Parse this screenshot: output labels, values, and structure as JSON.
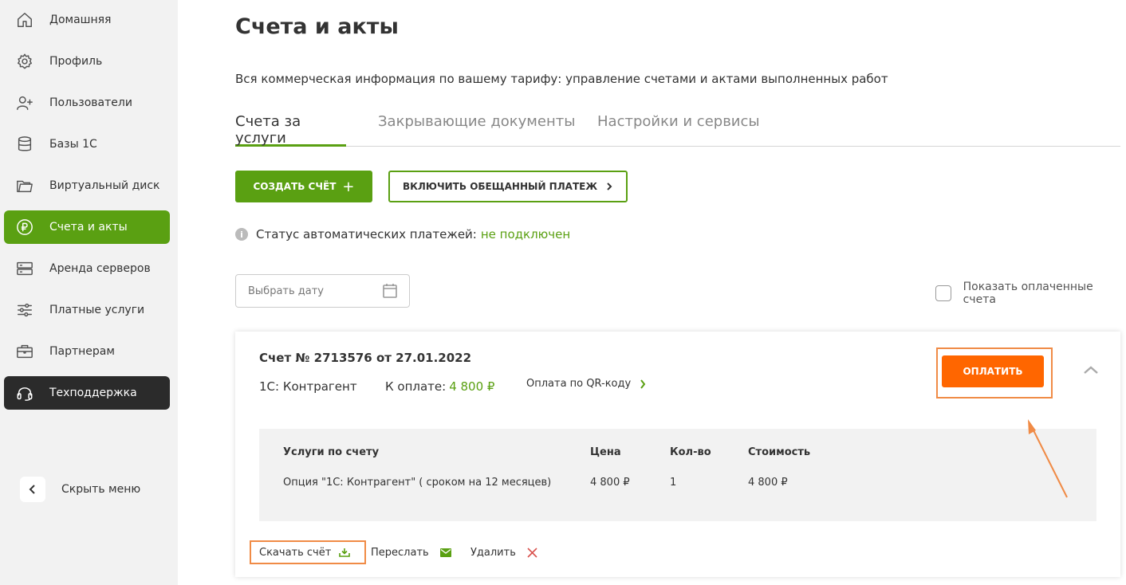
{
  "sidebar": {
    "items": [
      {
        "label": "Домашняя",
        "icon": "home-icon"
      },
      {
        "label": "Профиль",
        "icon": "gear-icon"
      },
      {
        "label": "Пользователи",
        "icon": "add-user-icon"
      },
      {
        "label": "Базы 1С",
        "icon": "database-icon"
      },
      {
        "label": "Виртуальный диск",
        "icon": "folder-icon"
      },
      {
        "label": "Счета и акты",
        "icon": "ruble-icon"
      },
      {
        "label": "Аренда серверов",
        "icon": "server-icon"
      },
      {
        "label": "Платные услуги",
        "icon": "sliders-icon"
      },
      {
        "label": "Партнерам",
        "icon": "briefcase-icon"
      },
      {
        "label": "Техподдержка",
        "icon": "headset-icon"
      }
    ],
    "hide_menu": "Скрыть меню"
  },
  "main": {
    "title": "Счета и акты",
    "subtitle": "Вся коммерческая информация по вашему тарифу: управление счетами и актами выполненных работ",
    "tabs": [
      {
        "label": "Счета за услуги"
      },
      {
        "label": "Закрывающие документы"
      },
      {
        "label": "Настройки и сервисы"
      }
    ],
    "create_button": "СОЗДАТЬ СЧЁТ",
    "create_plus": "+",
    "promise_button": "ВКЛЮЧИТЬ ОБЕЩАННЫЙ ПЛАТЕЖ",
    "status_info": "i",
    "status_label": "Статус автоматических платежей:",
    "status_value": "не подключен",
    "date_placeholder": "Выбрать дату",
    "show_paid": "Показать оплаченные счета"
  },
  "invoice": {
    "title": "Счет № 2713576 от 27.01.2022",
    "service": "1С: Контрагент",
    "due_label": "К оплате:",
    "due_amount": "4 800 ₽",
    "qr_link": "Оплата по QR-коду",
    "pay_button": "ОПЛАТИТЬ",
    "table": {
      "headers": [
        "Услуги по счету",
        "Цена",
        "Кол-во",
        "Стоимость"
      ],
      "rows": [
        [
          "Опция \"1С: Контрагент\" ( сроком на 12 месяцев)",
          "4 800 ₽",
          "1",
          "4 800 ₽"
        ]
      ]
    },
    "actions": {
      "download": "Скачать счёт",
      "forward": "Переслать",
      "delete": "Удалить"
    }
  },
  "colors": {
    "accent_green": "#5aa012",
    "pay_orange": "#ff6600",
    "highlight_orange": "#f08b46",
    "dark_item": "#2b2b2b"
  }
}
